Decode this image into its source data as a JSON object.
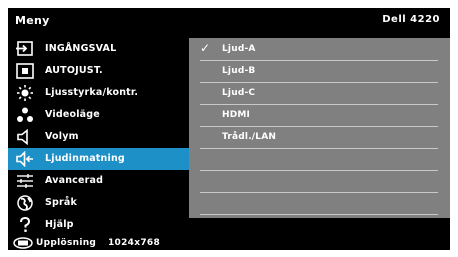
{
  "header": {
    "title": "Meny",
    "model": "Dell 4220"
  },
  "menu": [
    {
      "label": "INGÅNGSVAL",
      "icon": "input-source-icon"
    },
    {
      "label": "AUTOJUST.",
      "icon": "auto-adjust-icon"
    },
    {
      "label": "Ljusstyrka/kontr.",
      "icon": "brightness-icon"
    },
    {
      "label": "Videoläge",
      "icon": "video-mode-icon"
    },
    {
      "label": "Volym",
      "icon": "speaker-icon"
    },
    {
      "label": "Ljudinmatning",
      "icon": "audio-input-icon",
      "selected": true
    },
    {
      "label": "Avancerad",
      "icon": "sliders-icon"
    },
    {
      "label": "Språk",
      "icon": "globe-icon"
    },
    {
      "label": "Hjälp",
      "icon": "question-icon"
    }
  ],
  "options": [
    {
      "label": "Ljud-A",
      "checked": true
    },
    {
      "label": "Ljud-B"
    },
    {
      "label": "Ljud-C"
    },
    {
      "label": "HDMI"
    },
    {
      "label": "Trådl./LAN"
    },
    {
      "label": ""
    },
    {
      "label": ""
    },
    {
      "label": ""
    }
  ],
  "footer": {
    "label": "Upplösning",
    "value": "1024x768",
    "icon": "display-icon"
  },
  "colors": {
    "selected": "#1e90c8",
    "panel": "#808080",
    "background": "#000000"
  }
}
